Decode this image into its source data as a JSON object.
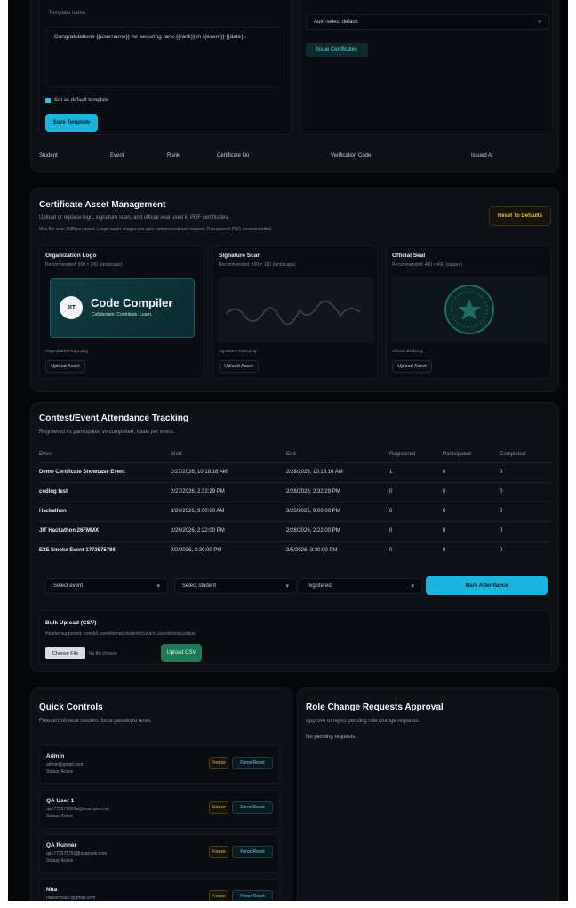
{
  "template_editor": {
    "name_label": "Template name",
    "body_text": "Congratulations {{username}} for securing rank {{rank}} in {{event}} {{date}}.",
    "default_checkbox_label": "Set as default template",
    "save_button": "Save Template"
  },
  "issue_panel": {
    "select_value": "Auto-select default",
    "issue_button": "Issue Certificates"
  },
  "certificates_table_headers": [
    "Student",
    "Event",
    "Rank",
    "Certificate No",
    "Verification Code",
    "Issued At"
  ],
  "asset_management": {
    "title": "Certificate Asset Management",
    "subtitle": "Upload or replace logo, signature scan, and official seal used in PDF certificates.",
    "note": "Max file size: 2MB per asset. Large raster images are auto-compressed and resized. Transparent PNG recommended.",
    "reset_button": "Reset To Defaults",
    "cards": [
      {
        "title": "Organization Logo",
        "hint": "Recommended: 600 × 200 (landscape)",
        "filename": "organization-logo.png",
        "upload": "Upload Asset",
        "logo_badge": "JIT",
        "logo_title": "Code Compiler",
        "logo_subtitle": "Collaborate. Contribute. Learn."
      },
      {
        "title": "Signature Scan",
        "hint": "Recommended: 600 × 180 (landscape)",
        "filename": "signature-scan.png",
        "upload": "Upload Asset"
      },
      {
        "title": "Official Seal",
        "hint": "Recommended: 400 × 400 (square)",
        "filename": "official-seal.png",
        "upload": "Upload Asset"
      }
    ]
  },
  "attendance": {
    "title": "Contest/Event Attendance Tracking",
    "subtitle": "Registered vs participated vs completed, totals per event.",
    "headers": [
      "Event",
      "Start",
      "End",
      "Registered",
      "Participated",
      "Completed"
    ],
    "rows": [
      [
        "Demo Certificate Showcase Event",
        "2/27/2026, 10:18:16 AM",
        "2/28/2026, 10:18:16 AM",
        "1",
        "0",
        "0"
      ],
      [
        "coding test",
        "2/27/2026, 2:32:29 PM",
        "2/28/2026, 2:32:29 PM",
        "0",
        "0",
        "0"
      ],
      [
        "Hackathon",
        "3/20/2026, 9:00:00 AM",
        "3/20/2026, 9:00:00 PM",
        "0",
        "0",
        "0"
      ],
      [
        "JIT Hackathon 26FMMX",
        "2/26/2026, 2:22:00 PM",
        "2/28/2026, 2:22:00 PM",
        "0",
        "0",
        "0"
      ],
      [
        "E2E Smoke Event 1772575786",
        "3/2/2026, 3:30:00 PM",
        "3/5/2026, 3:30:00 PM",
        "0",
        "0",
        "0"
      ]
    ],
    "select_event": "Select event",
    "select_student": "Select student",
    "select_status": "registered",
    "mark_button": "Mark Attendance",
    "bulk_title": "Bulk Upload (CSV)",
    "bulk_hint": "Header supported: eventId,userId/email,studentId,userId,userId/email,status",
    "choose_file": "Choose File",
    "no_file": "No file chosen",
    "upload_csv": "Upload CSV"
  },
  "quick_controls": {
    "title": "Quick Controls",
    "subtitle": "Freeze/Unfreeze student, force password reset.",
    "users": [
      {
        "name": "Admin",
        "email": "admin@gmail.com",
        "status": "Status: Active",
        "freeze": "Freeze",
        "force": "Force Reset"
      },
      {
        "name": "QA User 1",
        "email": "qa1772571656a@example.com",
        "status": "Status: Active",
        "freeze": "Freeze",
        "force": "Force Reset"
      },
      {
        "name": "QA Runner",
        "email": "qa1772575791@example.com",
        "status": "Status: Active",
        "freeze": "Freeze",
        "force": "Force Reset"
      },
      {
        "name": "Nita",
        "email": "nitaverma87@gmail.com",
        "status": "",
        "freeze": "Freeze",
        "force": "Force Reset"
      }
    ]
  },
  "role_requests": {
    "title": "Role Change Requests Approval",
    "subtitle": "Approve or reject pending role change requests.",
    "empty": "No pending requests."
  }
}
